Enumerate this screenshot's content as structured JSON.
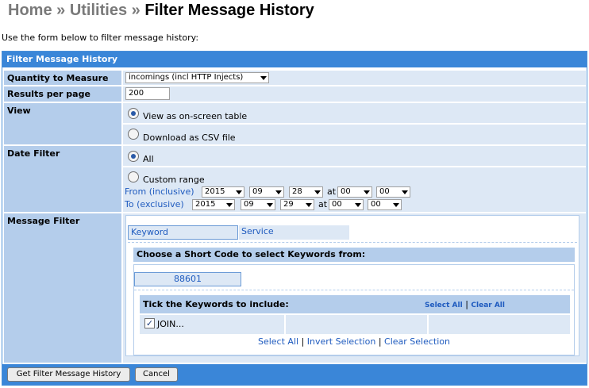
{
  "breadcrumb": {
    "home": "Home",
    "sep1": "»",
    "utilities": "Utilities",
    "sep2": "»",
    "current": "Filter Message History"
  },
  "intro": "Use the form below to filter message history:",
  "panel": {
    "title": "Filter Message History"
  },
  "quantity": {
    "label": "Quantity to Measure",
    "selected": "incomings (incl HTTP Injects)"
  },
  "results": {
    "label": "Results per page",
    "value": "200"
  },
  "view": {
    "label": "View",
    "option_table": "View as on-screen table",
    "option_csv": "Download as CSV file"
  },
  "date_filter": {
    "label": "Date Filter",
    "option_all": "All",
    "option_custom": "Custom range",
    "from_label": "From (inclusive)",
    "to_label": "To (exclusive)",
    "at": "at",
    "from": {
      "year": "2015",
      "month": "09",
      "day": "28",
      "hour": "00",
      "minute": "00"
    },
    "to": {
      "year": "2015",
      "month": "09",
      "day": "29",
      "hour": "00",
      "minute": "00"
    }
  },
  "message_filter": {
    "label": "Message Filter",
    "tab_keyword": "Keyword",
    "tab_service": "Service",
    "shortcode_heading": "Choose a Short Code to select Keywords from:",
    "shortcode": "88601",
    "keywords_heading": "Tick the Keywords to include:",
    "select_all_small": "Select All",
    "divider": "|",
    "clear_all_small": "Clear All",
    "keyword_item": "JOIN...",
    "select_all": "Select All",
    "invert_selection": "Invert Selection",
    "clear_selection": "Clear Selection"
  },
  "buttons": {
    "submit": "Get Filter Message History",
    "cancel": "Cancel"
  },
  "colors": {
    "header_blue": "#3a86d8",
    "label_blue": "#b4cdeb",
    "value_blue": "#dde8f5",
    "link_blue": "#1f5bbf"
  }
}
